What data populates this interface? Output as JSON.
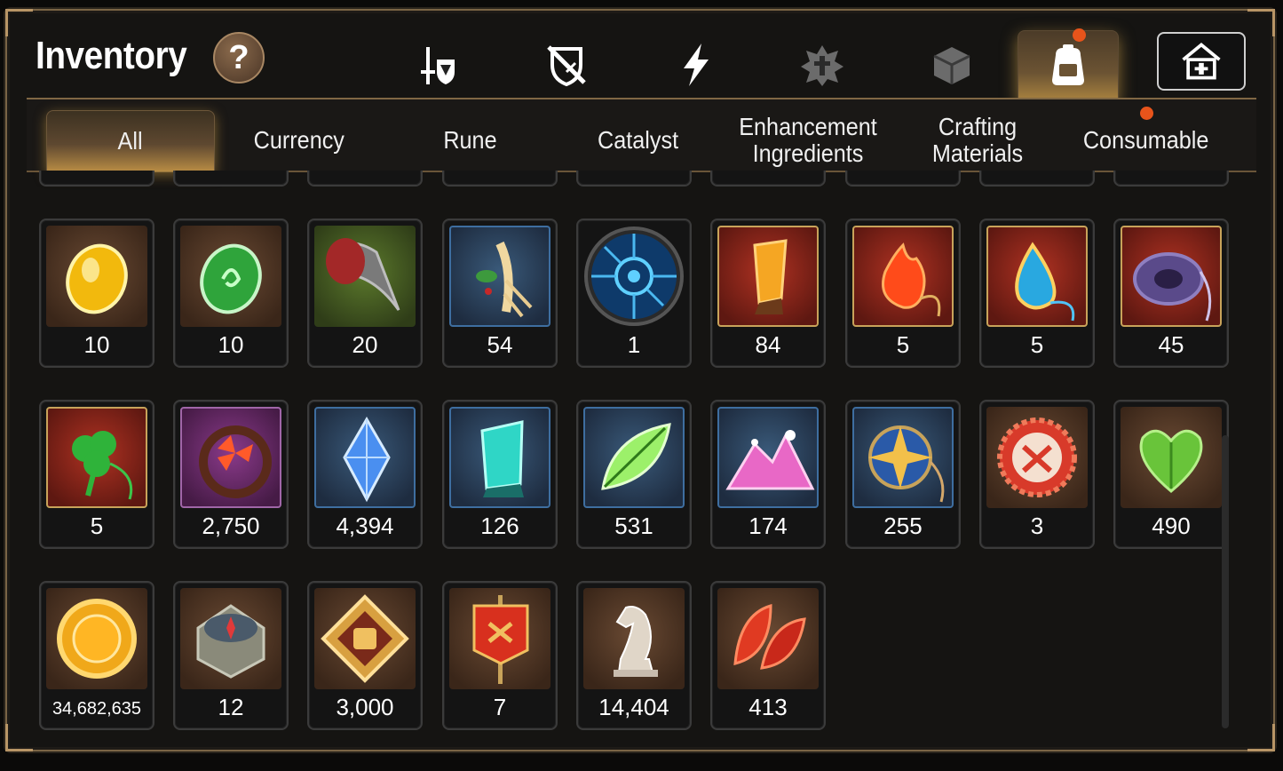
{
  "header": {
    "title": "Inventory",
    "help_label": "?"
  },
  "category_tabs": [
    {
      "icon": "sword-shield-icon",
      "active": false,
      "badge": false
    },
    {
      "icon": "crossed-shield-icon",
      "active": false,
      "badge": false
    },
    {
      "icon": "lightning-icon",
      "active": false,
      "badge": false
    },
    {
      "icon": "emblem-icon",
      "active": false,
      "badge": false
    },
    {
      "icon": "cube-icon",
      "active": false,
      "badge": false
    },
    {
      "icon": "backpack-icon",
      "active": true,
      "badge": true
    }
  ],
  "housing_button": {
    "icon": "house-icon"
  },
  "sub_tabs": [
    {
      "label": "All",
      "active": true,
      "badge": false
    },
    {
      "label": "Currency",
      "active": false,
      "badge": false
    },
    {
      "label": "Rune",
      "active": false,
      "badge": false
    },
    {
      "label": "Catalyst",
      "active": false,
      "badge": false
    },
    {
      "label": "Enhancement Ingredients",
      "active": false,
      "badge": false
    },
    {
      "label": "Crafting Materials",
      "active": false,
      "badge": false
    },
    {
      "label": "Consumable",
      "active": false,
      "badge": true
    }
  ],
  "rows": [
    {
      "items": [
        {
          "icon": "yellow-gem-icon",
          "frame": "brown",
          "qty": "10"
        },
        {
          "icon": "green-gem-icon",
          "frame": "brown",
          "qty": "10"
        },
        {
          "icon": "claw-icon",
          "frame": "green",
          "qty": "20"
        },
        {
          "icon": "root-herb-icon",
          "frame": "blue",
          "qty": "54"
        },
        {
          "icon": "rune-disc-icon",
          "frame": "round",
          "qty": "1"
        },
        {
          "icon": "amber-crystal-icon",
          "frame": "red",
          "qty": "84"
        },
        {
          "icon": "fire-pendant-icon",
          "frame": "red",
          "qty": "5"
        },
        {
          "icon": "water-pendant-icon",
          "frame": "red",
          "qty": "5"
        },
        {
          "icon": "ring-pendant-icon",
          "frame": "red",
          "qty": "45"
        }
      ]
    },
    {
      "items": [
        {
          "icon": "clover-pendant-icon",
          "frame": "red",
          "qty": "5"
        },
        {
          "icon": "flower-ring-icon",
          "frame": "purple",
          "qty": "2,750"
        },
        {
          "icon": "blue-crystal-icon",
          "frame": "blue",
          "qty": "4,394"
        },
        {
          "icon": "teal-crystal-icon",
          "frame": "blue",
          "qty": "126"
        },
        {
          "icon": "leaf-icon",
          "frame": "blue",
          "qty": "531"
        },
        {
          "icon": "pink-ore-icon",
          "frame": "blue",
          "qty": "174"
        },
        {
          "icon": "star-pendant-icon",
          "frame": "blue",
          "qty": "255"
        },
        {
          "icon": "bottlecap-icon",
          "frame": "brown",
          "qty": "3"
        },
        {
          "icon": "heart-leaf-icon",
          "frame": "brown",
          "qty": "490"
        }
      ]
    },
    {
      "items": [
        {
          "icon": "gold-coin-icon",
          "frame": "brown",
          "qty": "34,682,635",
          "small": true
        },
        {
          "icon": "compass-stone-icon",
          "frame": "brown",
          "qty": "12"
        },
        {
          "icon": "fist-badge-icon",
          "frame": "brown",
          "qty": "3,000"
        },
        {
          "icon": "banner-icon",
          "frame": "brown",
          "qty": "7"
        },
        {
          "icon": "chess-knight-icon",
          "frame": "brown",
          "qty": "14,404"
        },
        {
          "icon": "red-leaves-icon",
          "frame": "brown",
          "qty": "413"
        }
      ]
    }
  ],
  "colors": {
    "accent_gold": "#b88c44",
    "badge": "#e8541b",
    "panel_border": "#7a6445"
  }
}
